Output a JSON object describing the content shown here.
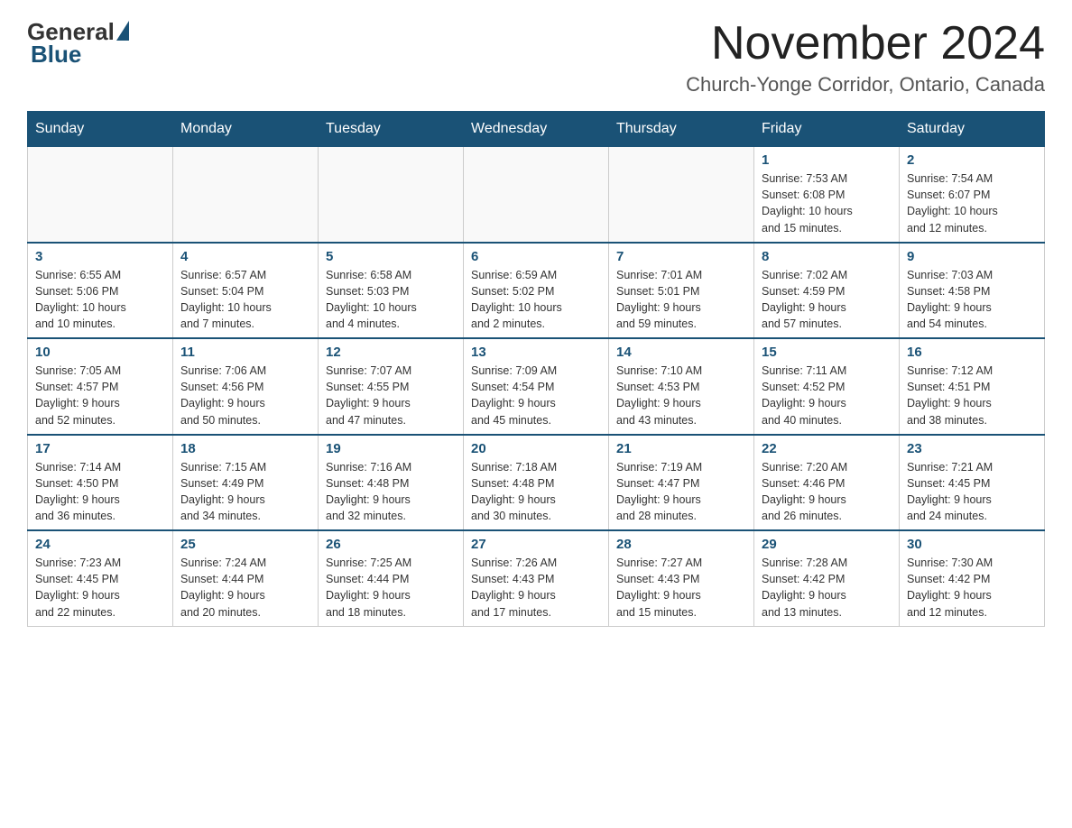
{
  "logo": {
    "general": "General",
    "blue": "Blue"
  },
  "header": {
    "month": "November 2024",
    "location": "Church-Yonge Corridor, Ontario, Canada"
  },
  "weekdays": [
    "Sunday",
    "Monday",
    "Tuesday",
    "Wednesday",
    "Thursday",
    "Friday",
    "Saturday"
  ],
  "weeks": [
    [
      {
        "day": "",
        "info": ""
      },
      {
        "day": "",
        "info": ""
      },
      {
        "day": "",
        "info": ""
      },
      {
        "day": "",
        "info": ""
      },
      {
        "day": "",
        "info": ""
      },
      {
        "day": "1",
        "info": "Sunrise: 7:53 AM\nSunset: 6:08 PM\nDaylight: 10 hours\nand 15 minutes."
      },
      {
        "day": "2",
        "info": "Sunrise: 7:54 AM\nSunset: 6:07 PM\nDaylight: 10 hours\nand 12 minutes."
      }
    ],
    [
      {
        "day": "3",
        "info": "Sunrise: 6:55 AM\nSunset: 5:06 PM\nDaylight: 10 hours\nand 10 minutes."
      },
      {
        "day": "4",
        "info": "Sunrise: 6:57 AM\nSunset: 5:04 PM\nDaylight: 10 hours\nand 7 minutes."
      },
      {
        "day": "5",
        "info": "Sunrise: 6:58 AM\nSunset: 5:03 PM\nDaylight: 10 hours\nand 4 minutes."
      },
      {
        "day": "6",
        "info": "Sunrise: 6:59 AM\nSunset: 5:02 PM\nDaylight: 10 hours\nand 2 minutes."
      },
      {
        "day": "7",
        "info": "Sunrise: 7:01 AM\nSunset: 5:01 PM\nDaylight: 9 hours\nand 59 minutes."
      },
      {
        "day": "8",
        "info": "Sunrise: 7:02 AM\nSunset: 4:59 PM\nDaylight: 9 hours\nand 57 minutes."
      },
      {
        "day": "9",
        "info": "Sunrise: 7:03 AM\nSunset: 4:58 PM\nDaylight: 9 hours\nand 54 minutes."
      }
    ],
    [
      {
        "day": "10",
        "info": "Sunrise: 7:05 AM\nSunset: 4:57 PM\nDaylight: 9 hours\nand 52 minutes."
      },
      {
        "day": "11",
        "info": "Sunrise: 7:06 AM\nSunset: 4:56 PM\nDaylight: 9 hours\nand 50 minutes."
      },
      {
        "day": "12",
        "info": "Sunrise: 7:07 AM\nSunset: 4:55 PM\nDaylight: 9 hours\nand 47 minutes."
      },
      {
        "day": "13",
        "info": "Sunrise: 7:09 AM\nSunset: 4:54 PM\nDaylight: 9 hours\nand 45 minutes."
      },
      {
        "day": "14",
        "info": "Sunrise: 7:10 AM\nSunset: 4:53 PM\nDaylight: 9 hours\nand 43 minutes."
      },
      {
        "day": "15",
        "info": "Sunrise: 7:11 AM\nSunset: 4:52 PM\nDaylight: 9 hours\nand 40 minutes."
      },
      {
        "day": "16",
        "info": "Sunrise: 7:12 AM\nSunset: 4:51 PM\nDaylight: 9 hours\nand 38 minutes."
      }
    ],
    [
      {
        "day": "17",
        "info": "Sunrise: 7:14 AM\nSunset: 4:50 PM\nDaylight: 9 hours\nand 36 minutes."
      },
      {
        "day": "18",
        "info": "Sunrise: 7:15 AM\nSunset: 4:49 PM\nDaylight: 9 hours\nand 34 minutes."
      },
      {
        "day": "19",
        "info": "Sunrise: 7:16 AM\nSunset: 4:48 PM\nDaylight: 9 hours\nand 32 minutes."
      },
      {
        "day": "20",
        "info": "Sunrise: 7:18 AM\nSunset: 4:48 PM\nDaylight: 9 hours\nand 30 minutes."
      },
      {
        "day": "21",
        "info": "Sunrise: 7:19 AM\nSunset: 4:47 PM\nDaylight: 9 hours\nand 28 minutes."
      },
      {
        "day": "22",
        "info": "Sunrise: 7:20 AM\nSunset: 4:46 PM\nDaylight: 9 hours\nand 26 minutes."
      },
      {
        "day": "23",
        "info": "Sunrise: 7:21 AM\nSunset: 4:45 PM\nDaylight: 9 hours\nand 24 minutes."
      }
    ],
    [
      {
        "day": "24",
        "info": "Sunrise: 7:23 AM\nSunset: 4:45 PM\nDaylight: 9 hours\nand 22 minutes."
      },
      {
        "day": "25",
        "info": "Sunrise: 7:24 AM\nSunset: 4:44 PM\nDaylight: 9 hours\nand 20 minutes."
      },
      {
        "day": "26",
        "info": "Sunrise: 7:25 AM\nSunset: 4:44 PM\nDaylight: 9 hours\nand 18 minutes."
      },
      {
        "day": "27",
        "info": "Sunrise: 7:26 AM\nSunset: 4:43 PM\nDaylight: 9 hours\nand 17 minutes."
      },
      {
        "day": "28",
        "info": "Sunrise: 7:27 AM\nSunset: 4:43 PM\nDaylight: 9 hours\nand 15 minutes."
      },
      {
        "day": "29",
        "info": "Sunrise: 7:28 AM\nSunset: 4:42 PM\nDaylight: 9 hours\nand 13 minutes."
      },
      {
        "day": "30",
        "info": "Sunrise: 7:30 AM\nSunset: 4:42 PM\nDaylight: 9 hours\nand 12 minutes."
      }
    ]
  ]
}
